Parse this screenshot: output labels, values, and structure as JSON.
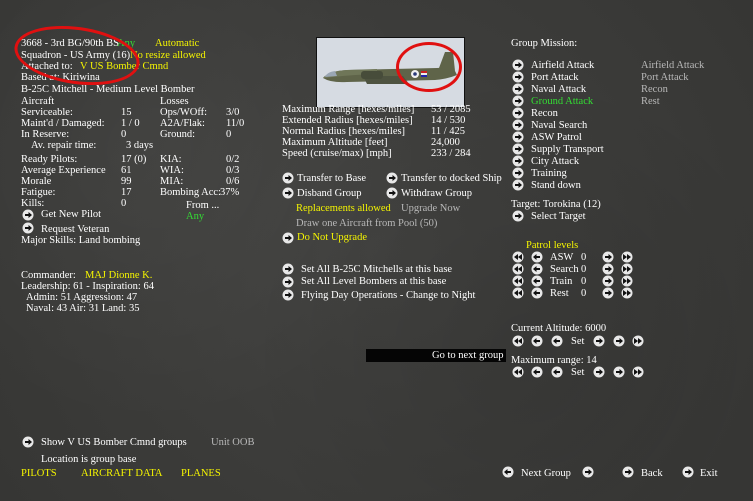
{
  "unit": {
    "id_name": "3668 - 3rd BG/90th BS",
    "any": "Any",
    "automatic": "Automatic",
    "squadron": "Squadron - US Army (16)",
    "no_resize": "No resize allowed",
    "attached_label": "Attached to:",
    "attached_to": "V US Bomber Cmnd",
    "based_at": "Based at: Kiriwina",
    "aircraft_type": "B-25C Mitchell - Medium Level Bomber"
  },
  "aircraft_stats": {
    "header": "Aircraft",
    "rows": [
      {
        "label": "Serviceable:",
        "value": "15"
      },
      {
        "label": "Maint'd / Damaged:",
        "value": "1 / 0"
      },
      {
        "label": "In Reserve:",
        "value": "0"
      }
    ],
    "repair_label": "Av. repair time:",
    "repair_value": "3 days"
  },
  "losses": {
    "header": "Losses",
    "rows": [
      {
        "label": "Ops/WOff:",
        "value": "3/0"
      },
      {
        "label": "A2A/Flak:",
        "value": "11/0"
      },
      {
        "label": "Ground:",
        "value": "0"
      }
    ]
  },
  "pilots": {
    "rows": [
      {
        "label": "Ready Pilots:",
        "value": "17 (0)"
      },
      {
        "label": "Average Experience",
        "value": "61"
      },
      {
        "label": "Morale",
        "value": "99"
      },
      {
        "label": "Fatigue:",
        "value": "17"
      },
      {
        "label": "Kills:",
        "value": "0"
      }
    ],
    "right_rows": [
      {
        "label": "KIA:",
        "value": "0/2"
      },
      {
        "label": "WIA:",
        "value": "0/3"
      },
      {
        "label": "MIA:",
        "value": "0/6"
      },
      {
        "label": "Bombing Acc:",
        "value": "37%"
      }
    ],
    "get_new_pilot": "Get New Pilot",
    "from_label": "From ...",
    "from_value": "Any",
    "request_veteran": "Request Veteran",
    "major_skills": "Major Skills:  Land bombing"
  },
  "commander": {
    "label": "Commander:",
    "name": "MAJ Dionne K.",
    "leadership": "Leadership: 61 - Inspiration: 64",
    "admin": "Admin: 51  Aggression: 47",
    "naval": "Naval: 43  Air: 31  Land: 35"
  },
  "performance": {
    "rows": [
      {
        "label": "Maximum Range [hexes/miles]",
        "value": "53 / 2085"
      },
      {
        "label": "Extended Radius [hexes/miles]",
        "value": "14 / 530"
      },
      {
        "label": "Normal Radius [hexes/miles]",
        "value": "11 / 425"
      },
      {
        "label": "Maximum Altitude [feet]",
        "value": "24,000"
      },
      {
        "label": "Speed (cruise/max) [mph]",
        "value": "233 / 284"
      }
    ]
  },
  "actions": {
    "transfer_base": "Transfer to Base",
    "transfer_ship": "Transfer to docked Ship",
    "disband": "Disband Group",
    "withdraw": "Withdraw Group",
    "replacements": "Replacements allowed",
    "upgrade_now": "Upgrade Now",
    "draw_one": "Draw one Aircraft from Pool (50)",
    "do_not_upgrade": "Do Not Upgrade",
    "set_all_type": "Set All B-25C Mitchells at this base",
    "set_all_level": "Set All Level Bombers at this base",
    "flying_day": "Flying Day Operations - Change to Night"
  },
  "go_next_group": "Go to next group",
  "mission": {
    "header": "Group Mission:",
    "items": [
      {
        "label": "Airfield Attack",
        "right": "Airfield Attack",
        "active": false
      },
      {
        "label": "Port Attack",
        "right": "Port Attack",
        "active": false
      },
      {
        "label": "Naval Attack",
        "right": "Recon",
        "active": false
      },
      {
        "label": "Ground Attack",
        "right": "Rest",
        "active": true
      },
      {
        "label": "Recon",
        "right": "",
        "active": false
      },
      {
        "label": "Naval Search",
        "right": "",
        "active": false
      },
      {
        "label": "ASW Patrol",
        "right": "",
        "active": false
      },
      {
        "label": "Supply Transport",
        "right": "",
        "active": false
      },
      {
        "label": "City Attack",
        "right": "",
        "active": false
      },
      {
        "label": "Training",
        "right": "",
        "active": false
      },
      {
        "label": "Stand down",
        "right": "",
        "active": false
      }
    ],
    "target": "Target: Torokina  (12)",
    "select_target": "Select Target"
  },
  "patrol": {
    "header": "Patrol levels",
    "rows": [
      {
        "label": "ASW",
        "value": "0"
      },
      {
        "label": "Search",
        "value": "0"
      },
      {
        "label": "Train",
        "value": "0"
      },
      {
        "label": "Rest",
        "value": "0"
      }
    ]
  },
  "altitude": {
    "label": "Current Altitude: 6000",
    "set": "Set"
  },
  "max_range": {
    "label": "Maximum range: 14",
    "set": "Set"
  },
  "bottom": {
    "show_groups": "Show V US Bomber Cmnd  groups",
    "unit_oob": "Unit OOB",
    "location": "Location is group base",
    "pilots": "PILOTS",
    "aircraft_data": "AIRCRAFT DATA",
    "planes": "PLANES",
    "next_group": "Next Group",
    "back": "Back",
    "exit": "Exit"
  },
  "colors": {
    "yellow": "#f5f500",
    "green": "#33dd33",
    "annotation": "#e01010"
  }
}
